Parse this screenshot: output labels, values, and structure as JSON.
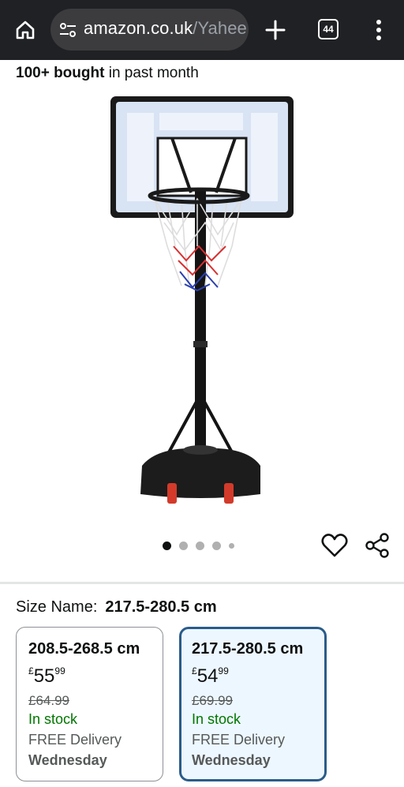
{
  "browser": {
    "url_host": "amazon.co.uk",
    "url_path": "/Yahee",
    "tab_count": "44",
    "icons": [
      "home-icon",
      "tune-icon",
      "plus-icon",
      "tab-switcher-icon",
      "more-vert-icon"
    ]
  },
  "product": {
    "bought_bold": "100+ bought",
    "bought_rest": " in past month",
    "image_icon": "basketball-hoop-image",
    "gallery_count": 5,
    "gallery_active": 0
  },
  "actions": {
    "icons": [
      "heart-icon",
      "share-icon"
    ]
  },
  "size": {
    "label": "Size Name:",
    "selected": "217.5-280.5 cm",
    "options": [
      {
        "name": "208.5-268.5 cm",
        "currency": "£",
        "price_whole": "55",
        "price_fraction": "99",
        "was_price": "£64.99",
        "stock": "In stock",
        "delivery": "FREE Delivery",
        "delivery_day": "Wednesday"
      },
      {
        "name": "217.5-280.5 cm",
        "currency": "£",
        "price_whole": "54",
        "price_fraction": "99",
        "was_price": "£69.99",
        "stock": "In stock",
        "delivery": "FREE Delivery",
        "delivery_day": "Wednesday"
      }
    ]
  },
  "colors": {
    "browser_bar": "#202124",
    "stock_green": "#007600",
    "selected_border": "#2a5c8a",
    "selected_bg": "#edf7ff"
  }
}
